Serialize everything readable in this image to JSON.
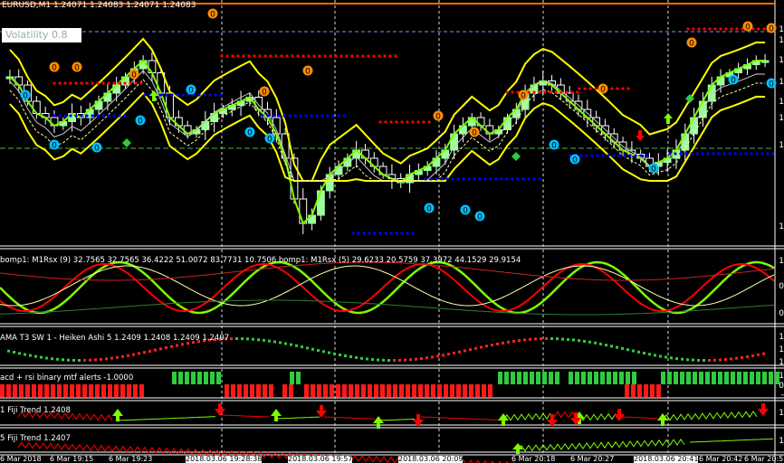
{
  "symbol_title": "EURUSD,M1  1.24071 1.24083 1.24071 1.24083",
  "volatility_label": "Volatility 0.8",
  "rsx_header": "bomp1: M1Rsx (9) 32.7565 32.7565 36.4222 51.0072 83.7731 10.7506  bomp1: M1Rsx (5) 29.6233 20.5759 37.3972 44.1529 29.9154",
  "heiken_header": "AMA T3 SW 1 -  Heiken Ashi 5 1.2409 1.2408 1.2409 1.2407",
  "macd_header": "acd + rsi binary mtf alerts -1.0000",
  "fiji1_header": "1  Fiji Trend 1.2408",
  "fiji5_header": "5  Fiji Trend 1.2407",
  "signal_top_symbol": "0",
  "signal_bottom_symbol": "0",
  "right_axis": {
    "main": [
      "1",
      "1",
      "1",
      "1",
      "1",
      "1",
      "1",
      "1"
    ],
    "rsx": [
      "1",
      "0",
      "0"
    ],
    "heiken": [
      "1",
      "1",
      "1"
    ],
    "macd": [
      "1",
      "0",
      "-"
    ],
    "fiji": [
      "1",
      "1"
    ]
  },
  "time_axis": [
    "6 Mar 2018",
    "6 Mar 19:15",
    "6 Mar 19:23",
    "2018.03.06 19:28:38",
    "2018.03.06 19:57",
    "2018.03.06 20:09",
    "6 Mar 20:18",
    "6 Mar 20:27",
    "2018.03.06 20:41",
    "6 Mar 20:42",
    "6 Mar 20:5"
  ],
  "colors": {
    "bull": "#7CFC00",
    "bear": "#FF0000",
    "band": "#FFFF00",
    "support": "#0000FF",
    "resistance": "#FF0000",
    "signal_top": "#FF8C00",
    "signal_bottom": "#00BFFF",
    "separator": "#FFFFFF"
  }
}
